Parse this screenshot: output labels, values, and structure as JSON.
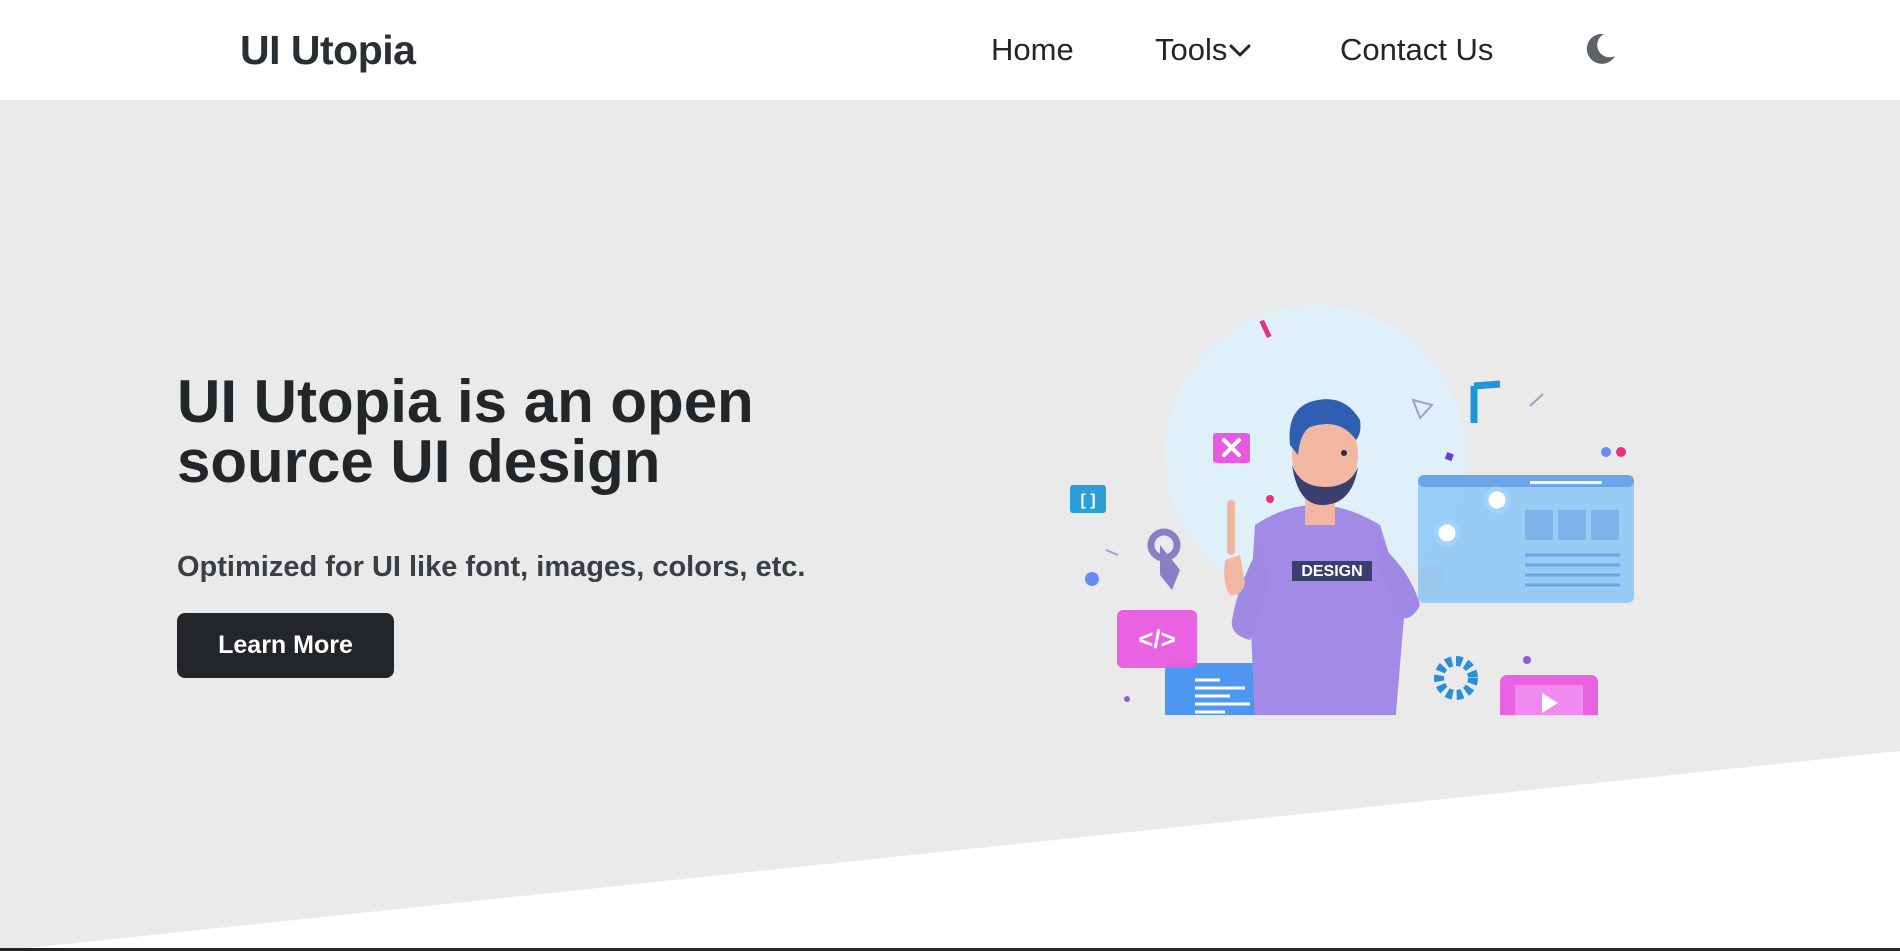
{
  "navbar": {
    "brand": "UI Utopia",
    "links": [
      {
        "label": "Home"
      },
      {
        "label": "Tools"
      },
      {
        "label": "Contact Us"
      }
    ],
    "theme_toggle_icon": "moon-icon",
    "dropdown_icon": "chevron-down-icon"
  },
  "hero": {
    "title_line1": "UI Utopia is an open",
    "title_line2": "source UI design",
    "subtitle": "Optimized for UI like font, images, colors, etc.",
    "cta_label": "Learn More",
    "illustration": {
      "shirt_text": "DESIGN",
      "code_tag": "</>",
      "bracket_tag": "[ ]"
    }
  },
  "colors": {
    "hero_bg": "#eaeaea",
    "text_dark": "#222628",
    "accent_purple": "#9f8ee6",
    "accent_pink": "#e85be0",
    "accent_blue": "#3f8ff2"
  }
}
